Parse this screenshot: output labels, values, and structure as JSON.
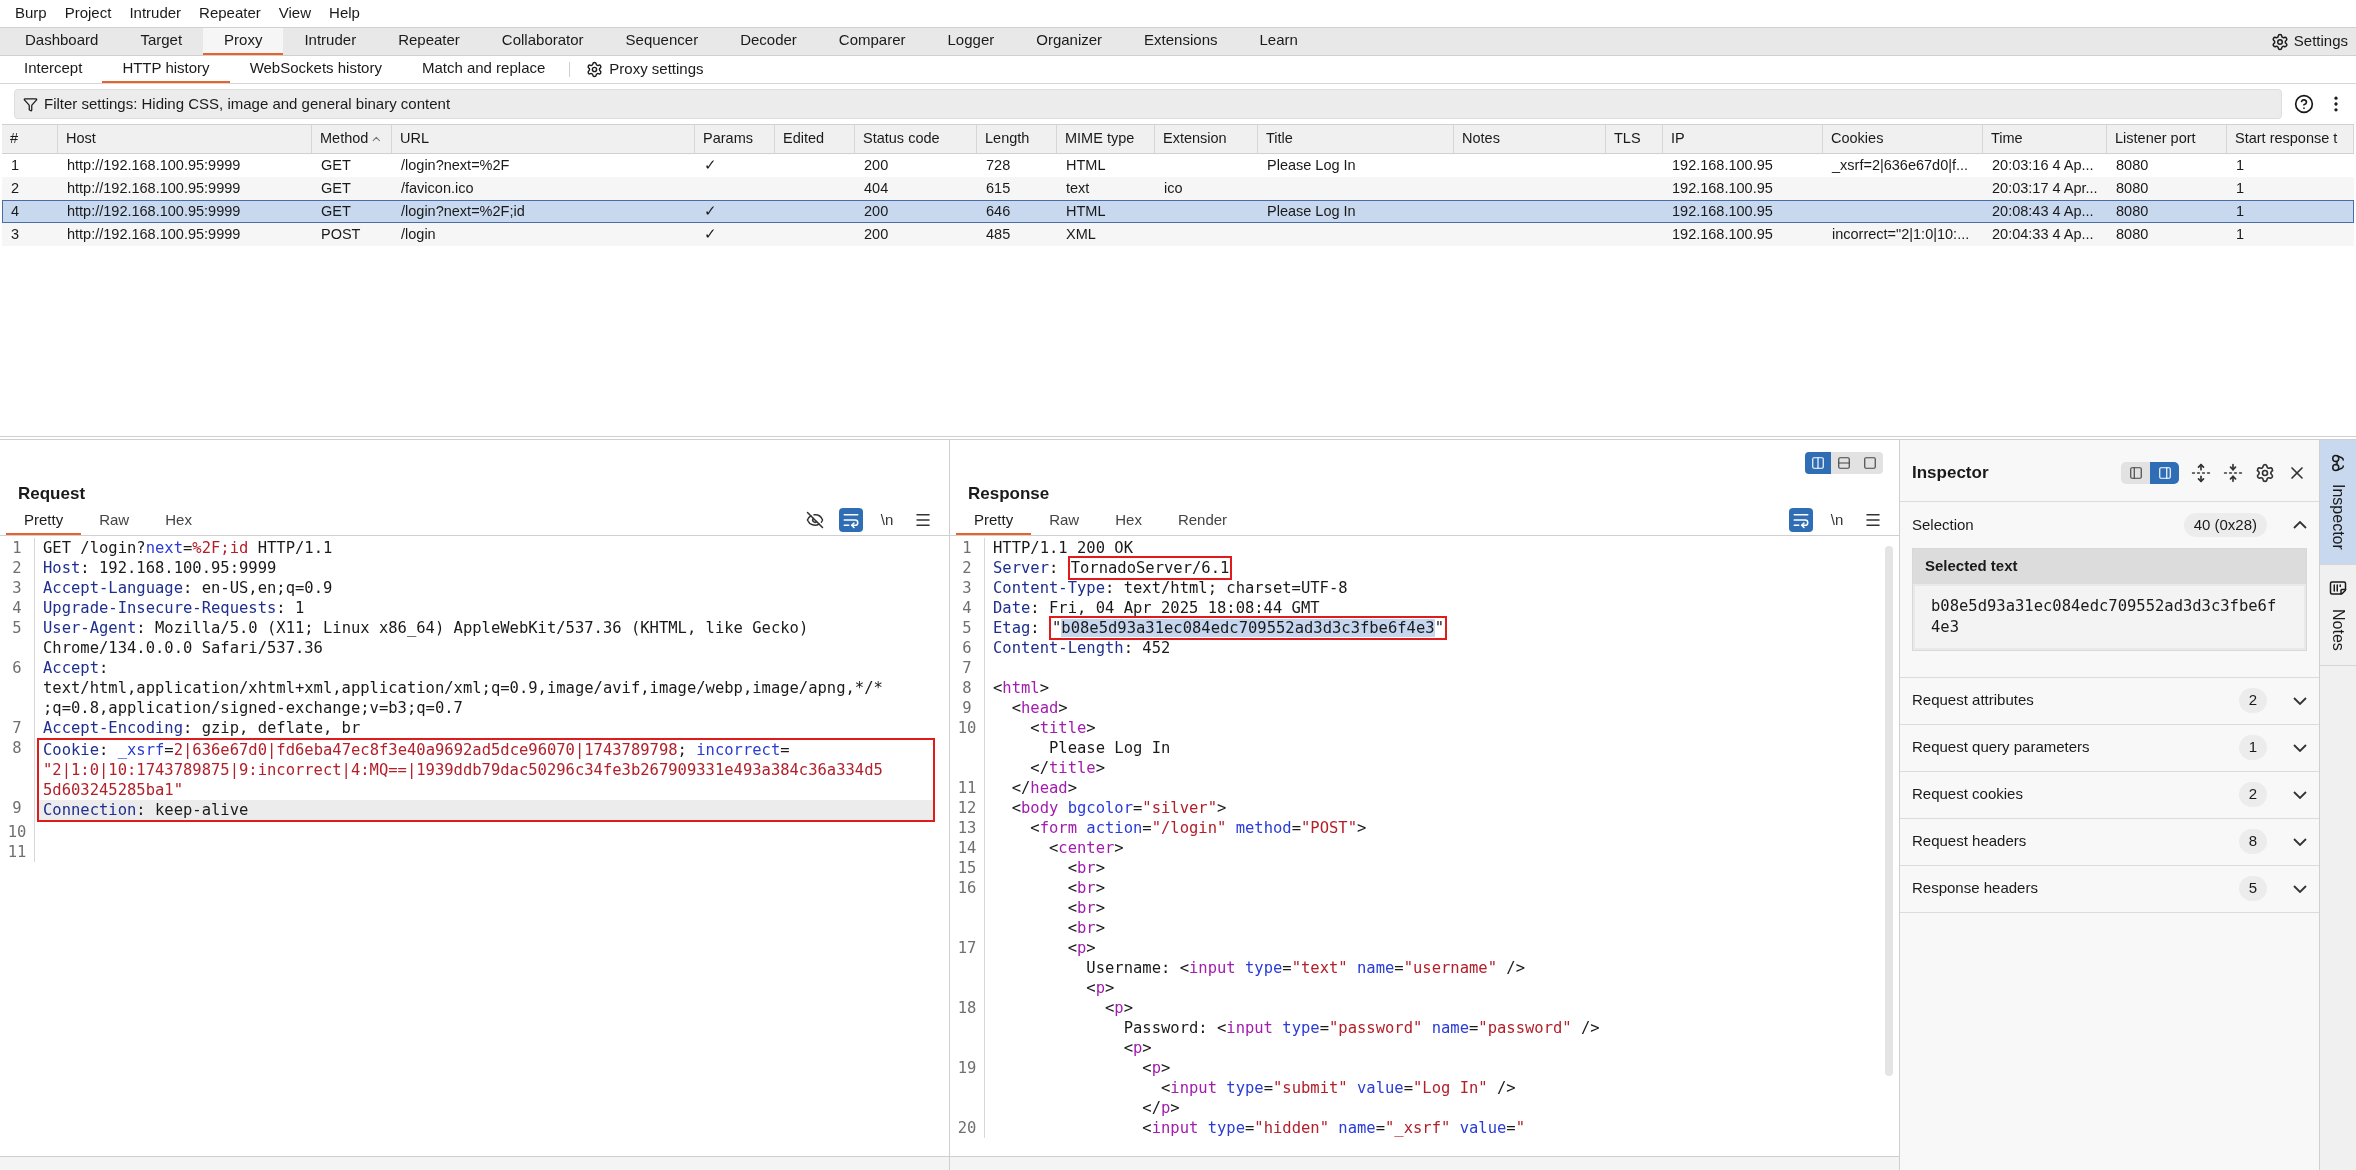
{
  "menu": [
    "Burp",
    "Project",
    "Intruder",
    "Repeater",
    "View",
    "Help"
  ],
  "main_tabs": [
    {
      "label": "Dashboard",
      "selected": false
    },
    {
      "label": "Target",
      "selected": false
    },
    {
      "label": "Proxy",
      "selected": true
    },
    {
      "label": "Intruder",
      "selected": false
    },
    {
      "label": "Repeater",
      "selected": false
    },
    {
      "label": "Collaborator",
      "selected": false
    },
    {
      "label": "Sequencer",
      "selected": false
    },
    {
      "label": "Decoder",
      "selected": false
    },
    {
      "label": "Comparer",
      "selected": false
    },
    {
      "label": "Logger",
      "selected": false
    },
    {
      "label": "Organizer",
      "selected": false
    },
    {
      "label": "Extensions",
      "selected": false
    },
    {
      "label": "Learn",
      "selected": false
    }
  ],
  "settings_button": "Settings",
  "sub_tabs": [
    {
      "label": "Intercept",
      "selected": false
    },
    {
      "label": "HTTP history",
      "selected": true
    },
    {
      "label": "WebSockets history",
      "selected": false
    },
    {
      "label": "Match and replace",
      "selected": false
    }
  ],
  "proxy_settings": "Proxy settings",
  "filter": "Filter settings: Hiding CSS, image and general binary content",
  "history": {
    "columns": [
      {
        "label": "#",
        "sorted": false
      },
      {
        "label": "Host",
        "sorted": false
      },
      {
        "label": "Method",
        "sorted": true
      },
      {
        "label": "URL",
        "sorted": false
      },
      {
        "label": "Params",
        "sorted": false
      },
      {
        "label": "Edited",
        "sorted": false
      },
      {
        "label": "Status code",
        "sorted": false
      },
      {
        "label": "Length",
        "sorted": false
      },
      {
        "label": "MIME type",
        "sorted": false
      },
      {
        "label": "Extension",
        "sorted": false
      },
      {
        "label": "Title",
        "sorted": false
      },
      {
        "label": "Notes",
        "sorted": false
      },
      {
        "label": "TLS",
        "sorted": false
      },
      {
        "label": "IP",
        "sorted": false
      },
      {
        "label": "Cookies",
        "sorted": false
      },
      {
        "label": "Time",
        "sorted": false
      },
      {
        "label": "Listener port",
        "sorted": false
      },
      {
        "label": "Start response t",
        "sorted": false
      }
    ],
    "rows": [
      {
        "selected": false,
        "cells": [
          "1",
          "http://192.168.100.95:9999",
          "GET",
          "/login?next=%2F",
          "✓",
          null,
          "200",
          "728",
          "HTML",
          null,
          "Please Log In",
          null,
          null,
          "192.168.100.95",
          "_xsrf=2|636e67d0|f...",
          "20:03:16 4 Ap...",
          "8080",
          "1"
        ]
      },
      {
        "selected": false,
        "cells": [
          "2",
          "http://192.168.100.95:9999",
          "GET",
          "/favicon.ico",
          null,
          null,
          "404",
          "615",
          "text",
          "ico",
          null,
          null,
          null,
          "192.168.100.95",
          null,
          "20:03:17 4 Apr...",
          "8080",
          "1"
        ]
      },
      {
        "selected": true,
        "cells": [
          "4",
          "http://192.168.100.95:9999",
          "GET",
          "/login?next=%2F;id",
          "✓",
          null,
          "200",
          "646",
          "HTML",
          null,
          "Please Log In",
          null,
          null,
          "192.168.100.95",
          null,
          "20:08:43 4 Ap...",
          "8080",
          "1"
        ]
      },
      {
        "selected": false,
        "cells": [
          "3",
          "http://192.168.100.95:9999",
          "POST",
          "/login",
          "✓",
          null,
          "200",
          "485",
          "XML",
          null,
          null,
          null,
          null,
          "192.168.100.95",
          "incorrect=\"2|1:0|10:...",
          "20:04:33 4 Ap...",
          "8080",
          "1"
        ]
      }
    ]
  },
  "request": {
    "title": "Request",
    "tabs": [
      {
        "label": "Pretty",
        "selected": true
      },
      {
        "label": "Raw",
        "selected": false
      },
      {
        "label": "Hex",
        "selected": false
      }
    ],
    "tools": [
      {
        "kind": "hide",
        "on": false
      },
      {
        "kind": "wrap",
        "on": true
      },
      {
        "kind": "newline",
        "label": "\\n",
        "on": false
      },
      {
        "kind": "menu",
        "on": false
      }
    ],
    "rows": [
      {
        "n": "1",
        "boxed": false,
        "highlighted": false,
        "segs": [
          {
            "kind": "plain",
            "text": "GET /login?"
          },
          {
            "kind": "attr",
            "text": "next"
          },
          {
            "kind": "plain",
            "text": "="
          },
          {
            "kind": "value",
            "text": "%2F;id"
          },
          {
            "kind": "plain",
            "text": " HTTP/1.1"
          }
        ]
      },
      {
        "n": "2",
        "boxed": false,
        "highlighted": false,
        "segs": [
          {
            "kind": "key",
            "text": "Host"
          },
          {
            "kind": "plain",
            "text": ": 192.168.100.95:9999"
          }
        ]
      },
      {
        "n": "3",
        "boxed": false,
        "highlighted": false,
        "segs": [
          {
            "kind": "key",
            "text": "Accept-Language"
          },
          {
            "kind": "plain",
            "text": ": en-US,en;q=0.9"
          }
        ]
      },
      {
        "n": "4",
        "boxed": false,
        "highlighted": false,
        "segs": [
          {
            "kind": "key",
            "text": "Upgrade-Insecure-Requests"
          },
          {
            "kind": "plain",
            "text": ": 1"
          }
        ]
      },
      {
        "n": "5",
        "boxed": false,
        "highlighted": false,
        "segs": [
          {
            "kind": "key",
            "text": "User-Agent"
          },
          {
            "kind": "plain",
            "text": ": Mozilla/5.0 (X11; Linux x86_64) AppleWebKit/537.36 (KHTML, like Gecko)"
          }
        ]
      },
      {
        "boxed": false,
        "highlighted": false,
        "segs": [
          {
            "kind": "plain",
            "text": "Chrome/134.0.0.0 Safari/537.36"
          }
        ]
      },
      {
        "n": "6",
        "boxed": false,
        "highlighted": false,
        "segs": [
          {
            "kind": "key",
            "text": "Accept"
          },
          {
            "kind": "plain",
            "text": ":"
          }
        ]
      },
      {
        "boxed": false,
        "highlighted": false,
        "segs": [
          {
            "kind": "plain",
            "text": "text/html,application/xhtml+xml,application/xml;q=0.9,image/avif,image/webp,image/apng,*/*"
          }
        ]
      },
      {
        "boxed": false,
        "highlighted": false,
        "segs": [
          {
            "kind": "plain",
            "text": ";q=0.8,application/signed-exchange;v=b3;q=0.7"
          }
        ]
      },
      {
        "n": "7",
        "boxed": false,
        "highlighted": false,
        "segs": [
          {
            "kind": "key",
            "text": "Accept-Encoding"
          },
          {
            "kind": "plain",
            "text": ": gzip, deflate, br"
          }
        ]
      },
      {
        "n": "8",
        "boxed": true,
        "highlighted": false,
        "segs": [
          {
            "kind": "key",
            "text": "Cookie"
          },
          {
            "kind": "plain",
            "text": ": "
          },
          {
            "kind": "attr",
            "text": "_xsrf"
          },
          {
            "kind": "plain",
            "text": "="
          },
          {
            "kind": "value",
            "text": "2|636e67d0|fd6eba47ec8f3e40a9692ad5dce96070|1743789798"
          },
          {
            "kind": "plain",
            "text": "; "
          },
          {
            "kind": "attr",
            "text": "incorrect"
          },
          {
            "kind": "plain",
            "text": "="
          }
        ]
      },
      {
        "boxed": true,
        "highlighted": false,
        "segs": [
          {
            "kind": "value",
            "text": "\"2|1:0|10:1743789875|9:incorrect|4:MQ==|1939ddb79dac50296c34fe3b267909331e493a384c36a334d5"
          }
        ]
      },
      {
        "boxed": true,
        "highlighted": false,
        "segs": [
          {
            "kind": "value",
            "text": "5d603245285ba1\""
          }
        ]
      },
      {
        "n": "9",
        "boxed": true,
        "highlighted": true,
        "segs": [
          {
            "kind": "key",
            "text": "Connection"
          },
          {
            "kind": "plain",
            "text": ": keep-alive"
          }
        ]
      },
      {
        "n": "10",
        "boxed": false,
        "highlighted": false,
        "segs": []
      },
      {
        "n": "11",
        "boxed": false,
        "highlighted": false,
        "segs": []
      }
    ]
  },
  "response": {
    "title": "Response",
    "layouts": [
      {
        "kind": "columns",
        "selected": true
      },
      {
        "kind": "rows",
        "selected": false
      },
      {
        "kind": "single",
        "selected": false
      }
    ],
    "tabs": [
      {
        "label": "Pretty",
        "selected": true
      },
      {
        "label": "Raw",
        "selected": false
      },
      {
        "label": "Hex",
        "selected": false
      },
      {
        "label": "Render",
        "selected": false
      }
    ],
    "tools": [
      {
        "kind": "wrap",
        "on": true
      },
      {
        "kind": "newline",
        "label": "\\n",
        "on": false
      },
      {
        "kind": "menu",
        "on": false
      }
    ],
    "rows": [
      {
        "n": "1",
        "boxed": false,
        "highlighted": false,
        "segs": [
          {
            "kind": "plain",
            "text": "HTTP/1.1 200 OK"
          }
        ]
      },
      {
        "n": "2",
        "boxed": false,
        "highlighted": false,
        "segs": [
          {
            "kind": "key",
            "text": "Server",
            "boxed": false,
            "selected": false
          },
          {
            "kind": "plain",
            "text": ": ",
            "boxed": false,
            "selected": false
          },
          {
            "kind": "plain",
            "text": "TornadoServer/6.1",
            "boxed": true,
            "selected": false
          }
        ]
      },
      {
        "n": "3",
        "boxed": false,
        "highlighted": false,
        "segs": [
          {
            "kind": "key",
            "text": "Content-Type"
          },
          {
            "kind": "plain",
            "text": ": text/html; charset=UTF-8"
          }
        ]
      },
      {
        "n": "4",
        "boxed": false,
        "highlighted": false,
        "segs": [
          {
            "kind": "key",
            "text": "Date"
          },
          {
            "kind": "plain",
            "text": ": Fri, 04 Apr 2025 18:08:44 GMT"
          }
        ]
      },
      {
        "n": "5",
        "boxed": false,
        "highlighted": false,
        "segs": [
          {
            "kind": "key",
            "text": "Etag",
            "boxed": false,
            "selected": false
          },
          {
            "kind": "plain",
            "text": ": ",
            "boxed": false,
            "selected": false
          },
          {
            "kind": "plain",
            "text": "\"",
            "boxed": true,
            "selected": false
          },
          {
            "kind": "plain",
            "text": "b08e5d93a31ec084edc709552ad3d3c3fbe6f4e3",
            "boxed": true,
            "selected": true
          },
          {
            "kind": "plain",
            "text": "\"",
            "boxed": true,
            "selected": false
          }
        ]
      },
      {
        "n": "6",
        "boxed": false,
        "highlighted": false,
        "segs": [
          {
            "kind": "key",
            "text": "Content-Length"
          },
          {
            "kind": "plain",
            "text": ": 452"
          }
        ]
      },
      {
        "n": "7",
        "boxed": false,
        "highlighted": false,
        "segs": []
      },
      {
        "n": "8",
        "boxed": false,
        "highlighted": false,
        "segs": [
          {
            "kind": "plain",
            "text": "<"
          },
          {
            "kind": "tag",
            "text": "html"
          },
          {
            "kind": "plain",
            "text": ">"
          }
        ]
      },
      {
        "n": "9",
        "boxed": false,
        "highlighted": false,
        "segs": [
          {
            "kind": "plain",
            "text": "  <"
          },
          {
            "kind": "tag",
            "text": "head"
          },
          {
            "kind": "plain",
            "text": ">"
          }
        ]
      },
      {
        "n": "10",
        "boxed": false,
        "highlighted": false,
        "segs": [
          {
            "kind": "plain",
            "text": "    <"
          },
          {
            "kind": "tag",
            "text": "title"
          },
          {
            "kind": "plain",
            "text": ">"
          }
        ]
      },
      {
        "boxed": false,
        "highlighted": false,
        "segs": [
          {
            "kind": "plain",
            "text": "      Please Log In"
          }
        ]
      },
      {
        "boxed": false,
        "highlighted": false,
        "segs": [
          {
            "kind": "plain",
            "text": "    </"
          },
          {
            "kind": "tag",
            "text": "title"
          },
          {
            "kind": "plain",
            "text": ">"
          }
        ]
      },
      {
        "n": "11",
        "boxed": false,
        "highlighted": false,
        "segs": [
          {
            "kind": "plain",
            "text": "  </"
          },
          {
            "kind": "tag",
            "text": "head"
          },
          {
            "kind": "plain",
            "text": ">"
          }
        ]
      },
      {
        "n": "12",
        "boxed": false,
        "highlighted": false,
        "segs": [
          {
            "kind": "plain",
            "text": "  <"
          },
          {
            "kind": "tag",
            "text": "body"
          },
          {
            "kind": "attr",
            "text": " bgcolor"
          },
          {
            "kind": "plain",
            "text": "="
          },
          {
            "kind": "value",
            "text": "\"silver\""
          },
          {
            "kind": "plain",
            "text": ">"
          }
        ]
      },
      {
        "n": "13",
        "boxed": false,
        "highlighted": false,
        "segs": [
          {
            "kind": "plain",
            "text": "    <"
          },
          {
            "kind": "tag",
            "text": "form"
          },
          {
            "kind": "attr",
            "text": " action"
          },
          {
            "kind": "plain",
            "text": "="
          },
          {
            "kind": "value",
            "text": "\"/login\""
          },
          {
            "kind": "attr",
            "text": " method"
          },
          {
            "kind": "plain",
            "text": "="
          },
          {
            "kind": "value",
            "text": "\"POST\""
          },
          {
            "kind": "plain",
            "text": ">"
          }
        ]
      },
      {
        "n": "14",
        "boxed": false,
        "highlighted": false,
        "segs": [
          {
            "kind": "plain",
            "text": "      <"
          },
          {
            "kind": "tag",
            "text": "center"
          },
          {
            "kind": "plain",
            "text": ">"
          }
        ]
      },
      {
        "n": "15",
        "boxed": false,
        "highlighted": false,
        "segs": [
          {
            "kind": "plain",
            "text": "        <"
          },
          {
            "kind": "tag",
            "text": "br"
          },
          {
            "kind": "plain",
            "text": ">"
          }
        ]
      },
      {
        "n": "16",
        "boxed": false,
        "highlighted": false,
        "segs": [
          {
            "kind": "plain",
            "text": "        <"
          },
          {
            "kind": "tag",
            "text": "br"
          },
          {
            "kind": "plain",
            "text": ">"
          }
        ]
      },
      {
        "boxed": false,
        "highlighted": false,
        "segs": [
          {
            "kind": "plain",
            "text": "        <"
          },
          {
            "kind": "tag",
            "text": "br"
          },
          {
            "kind": "plain",
            "text": ">"
          }
        ]
      },
      {
        "boxed": false,
        "highlighted": false,
        "segs": [
          {
            "kind": "plain",
            "text": "        <"
          },
          {
            "kind": "tag",
            "text": "br"
          },
          {
            "kind": "plain",
            "text": ">"
          }
        ]
      },
      {
        "n": "17",
        "boxed": false,
        "highlighted": false,
        "segs": [
          {
            "kind": "plain",
            "text": "        <"
          },
          {
            "kind": "tag",
            "text": "p"
          },
          {
            "kind": "plain",
            "text": ">"
          }
        ]
      },
      {
        "boxed": false,
        "highlighted": false,
        "segs": [
          {
            "kind": "plain",
            "text": "          Username: <"
          },
          {
            "kind": "tag",
            "text": "input"
          },
          {
            "kind": "attr",
            "text": " type"
          },
          {
            "kind": "plain",
            "text": "="
          },
          {
            "kind": "value",
            "text": "\"text\""
          },
          {
            "kind": "attr",
            "text": " name"
          },
          {
            "kind": "plain",
            "text": "="
          },
          {
            "kind": "value",
            "text": "\"username\""
          },
          {
            "kind": "plain",
            "text": " />"
          }
        ]
      },
      {
        "boxed": false,
        "highlighted": false,
        "segs": [
          {
            "kind": "plain",
            "text": "          <"
          },
          {
            "kind": "tag",
            "text": "p"
          },
          {
            "kind": "plain",
            "text": ">"
          }
        ]
      },
      {
        "n": "18",
        "boxed": false,
        "highlighted": false,
        "segs": [
          {
            "kind": "plain",
            "text": "            <"
          },
          {
            "kind": "tag",
            "text": "p"
          },
          {
            "kind": "plain",
            "text": ">"
          }
        ]
      },
      {
        "boxed": false,
        "highlighted": false,
        "segs": [
          {
            "kind": "plain",
            "text": "              Password: <"
          },
          {
            "kind": "tag",
            "text": "input"
          },
          {
            "kind": "attr",
            "text": " type"
          },
          {
            "kind": "plain",
            "text": "="
          },
          {
            "kind": "value",
            "text": "\"password\""
          },
          {
            "kind": "attr",
            "text": " name"
          },
          {
            "kind": "plain",
            "text": "="
          },
          {
            "kind": "value",
            "text": "\"password\""
          },
          {
            "kind": "plain",
            "text": " />"
          }
        ]
      },
      {
        "boxed": false,
        "highlighted": false,
        "segs": [
          {
            "kind": "plain",
            "text": "              <"
          },
          {
            "kind": "tag",
            "text": "p"
          },
          {
            "kind": "plain",
            "text": ">"
          }
        ]
      },
      {
        "n": "19",
        "boxed": false,
        "highlighted": false,
        "segs": [
          {
            "kind": "plain",
            "text": "                <"
          },
          {
            "kind": "tag",
            "text": "p"
          },
          {
            "kind": "plain",
            "text": ">"
          }
        ]
      },
      {
        "boxed": false,
        "highlighted": false,
        "segs": [
          {
            "kind": "plain",
            "text": "                  <"
          },
          {
            "kind": "tag",
            "text": "input"
          },
          {
            "kind": "attr",
            "text": " type"
          },
          {
            "kind": "plain",
            "text": "="
          },
          {
            "kind": "value",
            "text": "\"submit\""
          },
          {
            "kind": "attr",
            "text": " value"
          },
          {
            "kind": "plain",
            "text": "="
          },
          {
            "kind": "value",
            "text": "\"Log In\""
          },
          {
            "kind": "plain",
            "text": " />"
          }
        ]
      },
      {
        "boxed": false,
        "highlighted": false,
        "segs": [
          {
            "kind": "plain",
            "text": "                </"
          },
          {
            "kind": "tag",
            "text": "p"
          },
          {
            "kind": "plain",
            "text": ">"
          }
        ]
      },
      {
        "n": "20",
        "boxed": false,
        "highlighted": false,
        "segs": [
          {
            "kind": "plain",
            "text": "                <"
          },
          {
            "kind": "tag",
            "text": "input"
          },
          {
            "kind": "attr",
            "text": " type"
          },
          {
            "kind": "plain",
            "text": "="
          },
          {
            "kind": "value",
            "text": "\"hidden\""
          },
          {
            "kind": "attr",
            "text": " name"
          },
          {
            "kind": "plain",
            "text": "="
          },
          {
            "kind": "value",
            "text": "\"_xsrf\""
          },
          {
            "kind": "attr",
            "text": " value"
          },
          {
            "kind": "plain",
            "text": "="
          },
          {
            "kind": "value",
            "text": "\""
          }
        ]
      }
    ]
  },
  "inspector": {
    "title": "Inspector",
    "views": [
      {
        "kind": "left",
        "selected": false
      },
      {
        "kind": "right",
        "selected": true
      }
    ],
    "selection": {
      "label": "Selection",
      "count": "40 (0x28)",
      "expanded": true,
      "heading": "Selected text",
      "text": "b08e5d93a31ec084edc709552ad3d3c3fbe6f4e3"
    },
    "sections": [
      {
        "label": "Request attributes",
        "count": "2",
        "expanded": false
      },
      {
        "label": "Request query parameters",
        "count": "1",
        "expanded": false
      },
      {
        "label": "Request cookies",
        "count": "2",
        "expanded": false
      },
      {
        "label": "Request headers",
        "count": "8",
        "expanded": false
      },
      {
        "label": "Response headers",
        "count": "5",
        "expanded": false
      }
    ]
  },
  "side_tabs": [
    {
      "kind": "inspector",
      "label": "Inspector",
      "selected": true
    },
    {
      "kind": "notes",
      "label": "Notes",
      "selected": false
    }
  ]
}
